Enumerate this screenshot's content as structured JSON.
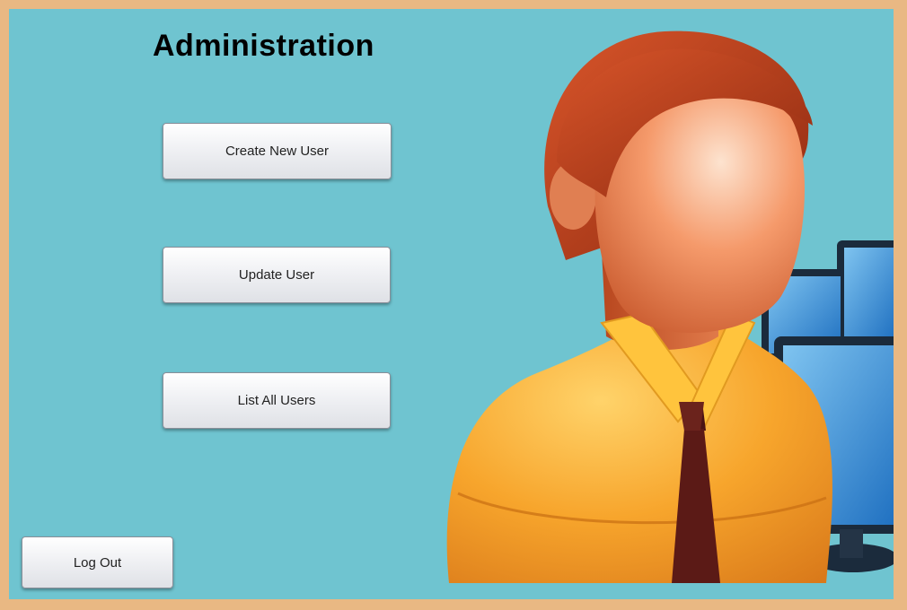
{
  "window": {
    "background_color": "#6fc4d0",
    "border_color": "#e9b883"
  },
  "page": {
    "title": "Administration"
  },
  "actions": {
    "create_user": "Create New User",
    "update_user": "Update User",
    "list_users": "List All Users",
    "log_out": "Log Out"
  },
  "illustration": {
    "icon": "user-avatar-with-monitors"
  }
}
